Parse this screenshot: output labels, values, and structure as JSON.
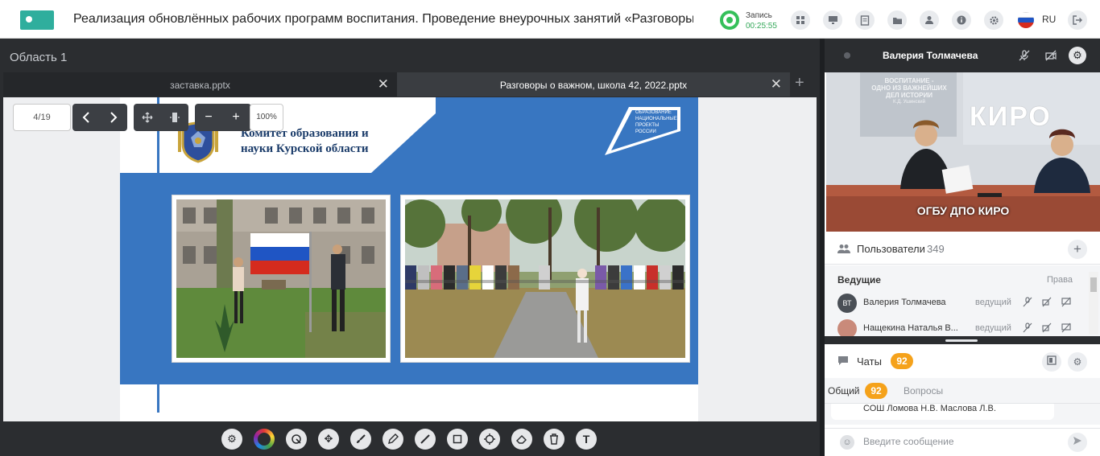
{
  "header": {
    "title": "Реализация обновлённых рабочих программ воспитания. Проведение внеурочных занятий «Разговоры о важном»...",
    "recording_label": "Запись",
    "recording_time": "00:25:55",
    "language": "RU",
    "icons": [
      "apps-icon",
      "screen-icon",
      "document-icon",
      "folder-icon",
      "user-settings-icon",
      "info-icon",
      "gear-icon",
      "flag-icon",
      "exit-icon"
    ]
  },
  "workspace": {
    "area_title": "Область 1",
    "tabs": [
      {
        "label": "заставка.pptx"
      },
      {
        "label": "Разговоры о важном, школа 42, 2022.pptx"
      }
    ],
    "page_indicator": "4/19",
    "zoom": "100%"
  },
  "slide": {
    "org_name_line1": "Комитет образования и",
    "org_name_line2": "науки Курской области",
    "project_line1": "ОБРАЗОВАНИЕ",
    "project_line2": "НАЦИОНАЛЬНЫЕ",
    "project_line3": "ПРОЕКТЫ",
    "project_line4": "РОССИИ"
  },
  "toolbar": {
    "tools": [
      "gear-icon",
      "color-picker-icon",
      "pointer-icon",
      "move-icon",
      "brush-icon",
      "pencil-icon",
      "line-icon",
      "rectangle-icon",
      "target-icon",
      "eraser-icon",
      "trash-icon",
      "text-icon"
    ]
  },
  "video": {
    "speaker_name": "Валерия Толмачева",
    "caption": "ОГБУ ДПО КИРО",
    "wall_text_line1": "ВОСПИТАНИЕ -",
    "wall_text_line2": "ОДНО ИЗ ВАЖНЕЙШИХ",
    "wall_text_line3": "ДЕЛ ИСТОРИИ",
    "wall_text_line4": "К.Д. Ушинский",
    "wall_logo": "КИРО"
  },
  "users": {
    "label": "Пользователи",
    "count": "349",
    "section": "Ведущие",
    "rights_label": "Права",
    "rows": [
      {
        "initials": "ВТ",
        "name": "Валерия Толмачева",
        "role": "ведущий"
      },
      {
        "initials": "",
        "name": "Нащекина Наталья В...",
        "role": "ведущий"
      }
    ]
  },
  "chat": {
    "label": "Чаты",
    "badge": "92",
    "tab_general": "Общий",
    "tab_general_badge": "92",
    "tab_questions": "Вопросы",
    "last_message": "СОШ Ломова Н.В. Маслова Л.В.",
    "input_placeholder": "Введите сообщение"
  },
  "colors": {
    "accent_orange": "#f5a21b",
    "recording_green": "#35c05a",
    "slide_blue": "#3876c1",
    "dark_bg": "#2b2d30"
  }
}
